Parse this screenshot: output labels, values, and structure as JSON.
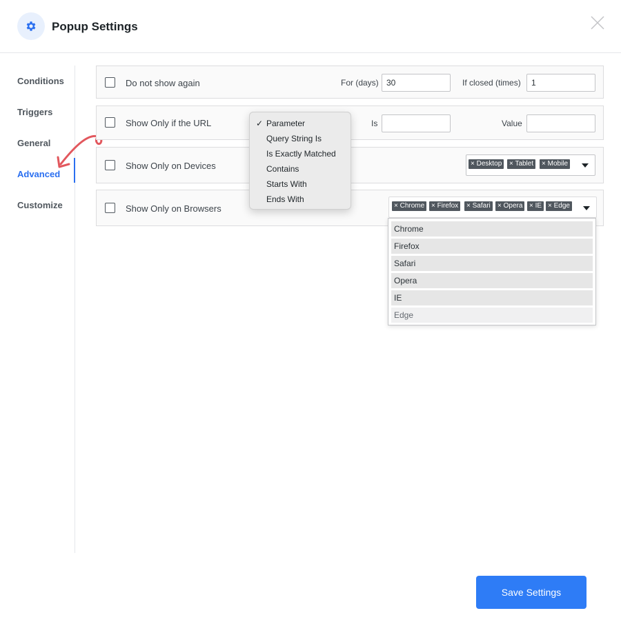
{
  "header": {
    "title": "Popup Settings",
    "icon": "gear-icon",
    "close_icon": "close-icon"
  },
  "sidebar": {
    "items": [
      {
        "label": "Conditions"
      },
      {
        "label": "Triggers"
      },
      {
        "label": "General"
      },
      {
        "label": "Advanced",
        "active": true
      },
      {
        "label": "Customize"
      }
    ]
  },
  "rows": {
    "do_not_show": {
      "label": "Do not show again",
      "days_label": "For (days)",
      "days_value": "30",
      "closed_label": "If closed (times)",
      "closed_value": "1"
    },
    "url": {
      "label": "Show Only if the URL",
      "is_label": "Is",
      "is_value": "",
      "value_label": "Value",
      "value_value": ""
    },
    "devices": {
      "label": "Show Only on Devices",
      "tags": [
        "Desktop",
        "Tablet",
        "Mobile"
      ]
    },
    "browsers": {
      "label": "Show Only on Browsers",
      "tags": [
        "Chrome",
        "Firefox",
        "Safari",
        "Opera",
        "IE",
        "Edge"
      ]
    }
  },
  "url_menu": {
    "check_glyph": "✓",
    "selected": "Parameter",
    "options": [
      "Parameter",
      "Query String Is",
      "Is Exactly Matched",
      "Contains",
      "Starts With",
      "Ends With"
    ]
  },
  "browser_dropdown": {
    "options": [
      "Chrome",
      "Firefox",
      "Safari",
      "Opera",
      "IE",
      "Edge"
    ]
  },
  "footer": {
    "save_label": "Save Settings"
  },
  "colors": {
    "accent": "#2e7cf6",
    "active_nav": "#2a6ff0",
    "tag_bg": "#50575e",
    "annotation_arrow": "#e2575d"
  }
}
